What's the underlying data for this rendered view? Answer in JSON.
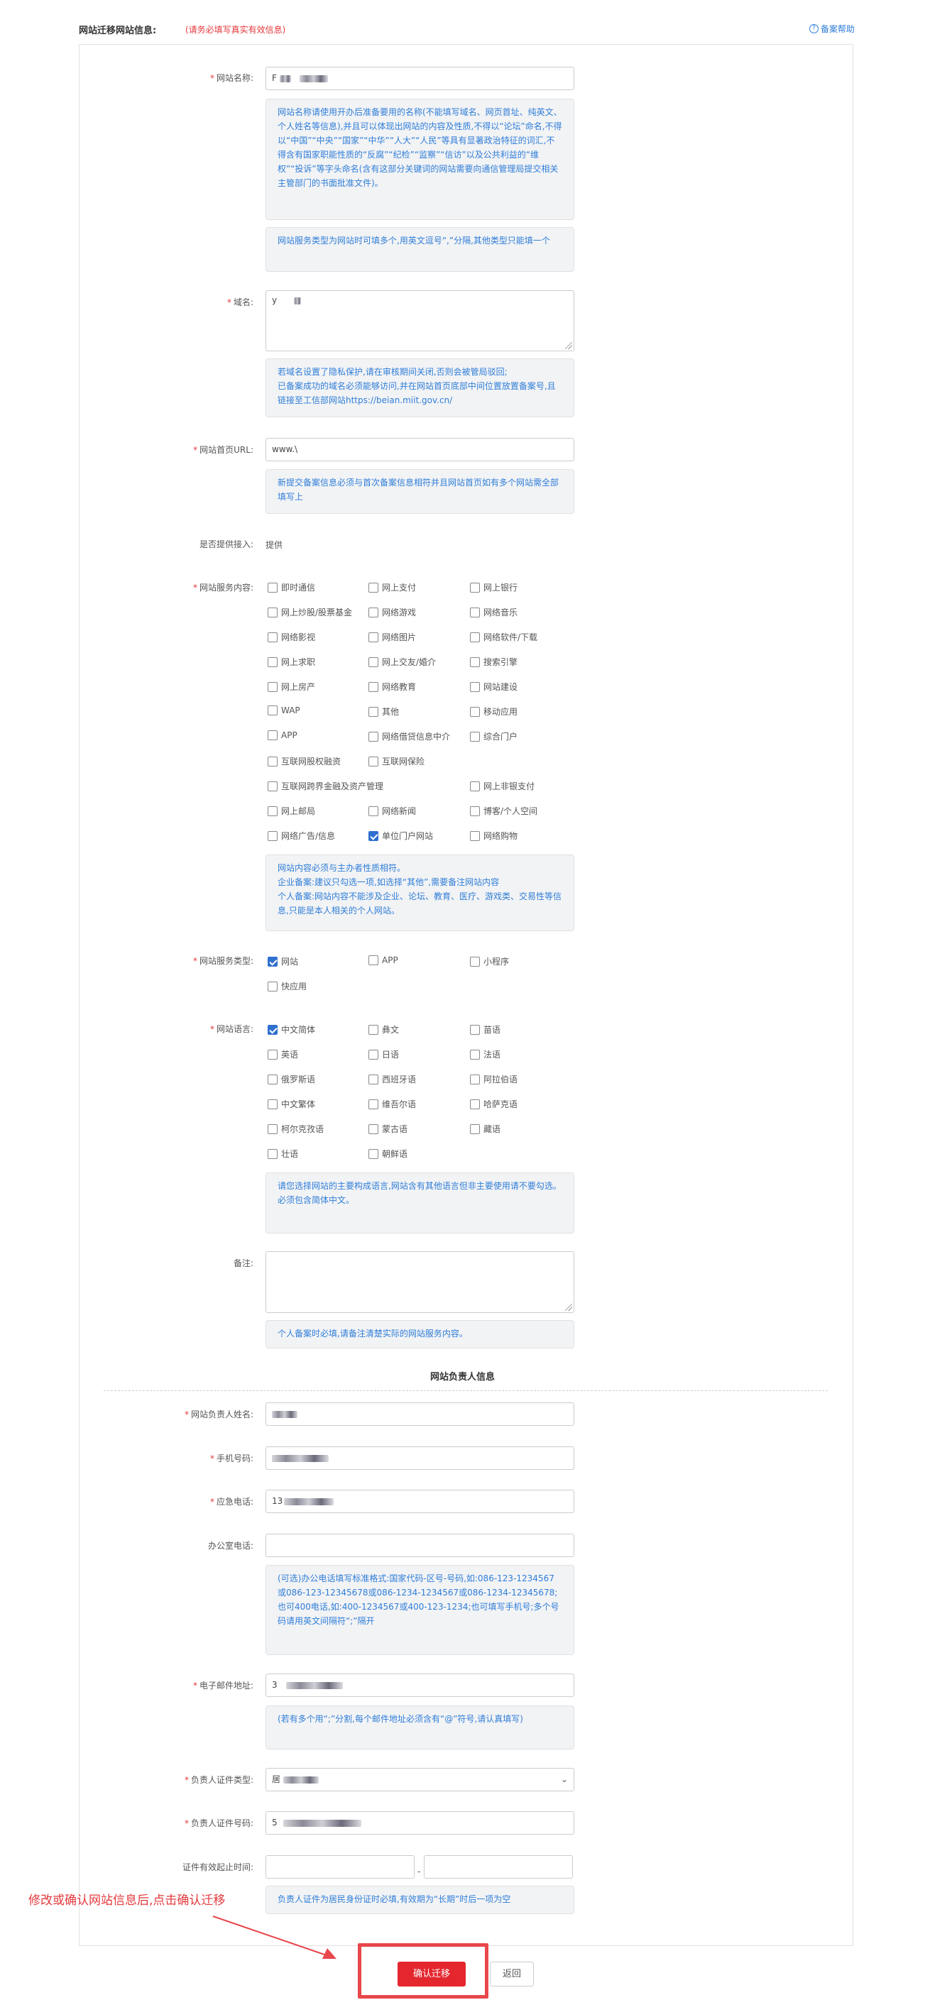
{
  "header": {
    "title": "网站迁移网站信息:",
    "notice": "(请务必填写真实有效信息)",
    "help": "备案帮助"
  },
  "site_name": {
    "label": "网站名称:",
    "value_prefix": "F",
    "tip1": "网站名称请使用开办后准备要用的名称(不能填写域名、网页首址、纯英文、个人姓名等信息),并且可以体现出网站的内容及性质,不得以“论坛”命名,不得以“中国”“中央”“国家”“中华”“人大”“人民”等具有显著政治特征的词汇,不得含有国家职能性质的“反腐”“纪检”“监察”“信访”以及公共利益的“维权”“投诉”等字头命名(含有这部分关键词的网站需要向通信管理局提交相关主管部门的书面批准文件)。",
    "tip2": "网站服务类型为网站时可填多个,用英文逗号“,”分隔,其他类型只能填一个"
  },
  "domain": {
    "label": "域名:",
    "value_prefix": "y",
    "tip": "若域名设置了隐私保护,请在审核期间关闭,否则会被管局驳回;\n已备案成功的域名必须能够访问,并在网站首页底部中间位置放置备案号,且链接至工信部网站https://beian.miit.gov.cn/"
  },
  "home_url": {
    "label": "网站首页URL:",
    "value": "www.\\",
    "tip": "新提交备案信息必须与首次备案信息相符并且网站首页如有多个网站需全部填写上"
  },
  "access": {
    "label": "是否提供接入:",
    "value": "提供"
  },
  "service_content": {
    "label": "网站服务内容:",
    "items": [
      {
        "label": "即时通信",
        "checked": false
      },
      {
        "label": "网上支付",
        "checked": false
      },
      {
        "label": "网上银行",
        "checked": false
      },
      {
        "label": "网上炒股/股票基金",
        "checked": false
      },
      {
        "label": "网络游戏",
        "checked": false
      },
      {
        "label": "网络音乐",
        "checked": false
      },
      {
        "label": "网络影视",
        "checked": false
      },
      {
        "label": "网络图片",
        "checked": false
      },
      {
        "label": "网络软件/下载",
        "checked": false
      },
      {
        "label": "网上求职",
        "checked": false
      },
      {
        "label": "网上交友/婚介",
        "checked": false
      },
      {
        "label": "搜索引擎",
        "checked": false
      },
      {
        "label": "网上房产",
        "checked": false
      },
      {
        "label": "网络教育",
        "checked": false
      },
      {
        "label": "网站建设",
        "checked": false
      },
      {
        "label": "WAP",
        "checked": false
      },
      {
        "label": "其他",
        "checked": false
      },
      {
        "label": "移动应用",
        "checked": false
      },
      {
        "label": "APP",
        "checked": false
      },
      {
        "label": "网络借贷信息中介",
        "checked": false
      },
      {
        "label": "综合门户",
        "checked": false
      },
      {
        "label": "互联网股权融资",
        "checked": false
      },
      {
        "label": "互联网保险",
        "checked": false
      },
      {
        "label": "互联网跨界金融及资产管理",
        "checked": false
      },
      {
        "label": "网上非银支付",
        "checked": false
      },
      {
        "label": "网上邮局",
        "checked": false
      },
      {
        "label": "网络新闻",
        "checked": false
      },
      {
        "label": "博客/个人空间",
        "checked": false
      },
      {
        "label": "网络广告/信息",
        "checked": false
      },
      {
        "label": "单位门户网站",
        "checked": true
      },
      {
        "label": "网络购物",
        "checked": false
      }
    ],
    "tip": "网站内容必须与主办者性质相符。\n企业备案:建议只勾选一项,如选择“其他”,需要备注网站内容\n个人备案:网站内容不能涉及企业、论坛、教育、医疗、游戏类、交易性等信息,只能是本人相关的个人网站。"
  },
  "service_type": {
    "label": "网站服务类型:",
    "items": [
      {
        "label": "网站",
        "checked": true
      },
      {
        "label": "APP",
        "checked": false
      },
      {
        "label": "小程序",
        "checked": false
      },
      {
        "label": "快应用",
        "checked": false
      }
    ]
  },
  "language": {
    "label": "网站语言:",
    "items": [
      {
        "label": "中文简体",
        "checked": true
      },
      {
        "label": "彝文",
        "checked": false
      },
      {
        "label": "苗语",
        "checked": false
      },
      {
        "label": "英语",
        "checked": false
      },
      {
        "label": "日语",
        "checked": false
      },
      {
        "label": "法语",
        "checked": false
      },
      {
        "label": "俄罗斯语",
        "checked": false
      },
      {
        "label": "西班牙语",
        "checked": false
      },
      {
        "label": "阿拉伯语",
        "checked": false
      },
      {
        "label": "中文繁体",
        "checked": false
      },
      {
        "label": "维吾尔语",
        "checked": false
      },
      {
        "label": "哈萨克语",
        "checked": false
      },
      {
        "label": "柯尔克孜语",
        "checked": false
      },
      {
        "label": "蒙古语",
        "checked": false
      },
      {
        "label": "藏语",
        "checked": false
      },
      {
        "label": "壮语",
        "checked": false
      },
      {
        "label": "朝鲜语",
        "checked": false
      }
    ],
    "tip": "请您选择网站的主要构成语言,网站含有其他语言但非主要使用请不要勾选。\n必须包含简体中文。"
  },
  "remark": {
    "label": "备注:",
    "tip": "个人备案时必填,请备注清楚实际的网站服务内容。"
  },
  "section": {
    "title": "网站负责人信息"
  },
  "manager": {
    "name_label": "网站负责人姓名:",
    "phone_label": "手机号码:",
    "emergency_label": "应急电话:",
    "emergency_prefix": "13",
    "office_label": "办公室电话:",
    "office_tip": "(可选)办公电话填写标准格式:国家代码-区号-号码,如:086-123-1234567或086-123-12345678或086-1234-1234567或086-1234-12345678;也可400电话,如:400-1234567或400-123-1234;也可填写手机号;多个号码请用英文间隔符“;”隔开",
    "email_label": "电子邮件地址:",
    "email_prefix": "3",
    "email_tip": "(若有多个用“;”分割,每个邮件地址必须含有“@”符号,请认真填写)",
    "id_type_label": "负责人证件类型:",
    "id_type_prefix": "居",
    "id_no_label": "负责人证件号码:",
    "id_no_prefix": "5",
    "valid_label": "证件有效起止时间:",
    "valid_sep": "-",
    "valid_tip": "负责人证件为居民身份证时必填,有效期为“长期”时后一项为空"
  },
  "annotation": "修改或确认网站信息后,点击确认迁移",
  "buttons": {
    "confirm": "确认迁移",
    "back": "返回"
  },
  "colors": {
    "accent": "#2f7ed8",
    "danger": "#e4262e",
    "required": "#e4393c"
  }
}
